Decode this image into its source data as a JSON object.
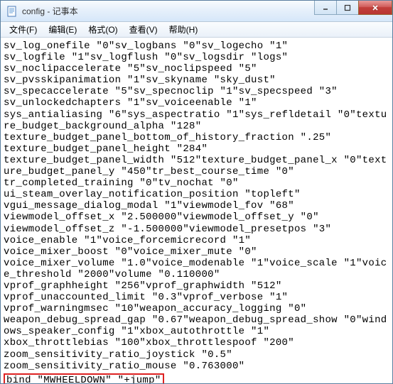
{
  "window": {
    "title": "config - 记事本"
  },
  "menu": {
    "file": "文件(F)",
    "edit": "编辑(E)",
    "format": "格式(O)",
    "view": "查看(V)",
    "help": "帮助(H)"
  },
  "content": {
    "lines": "sv_log_onefile \"0\"sv_logbans \"0\"sv_logecho \"1\"\nsv_logfile \"1\"sv_logflush \"0\"sv_logsdir \"logs\"\nsv_noclipaccelerate \"5\"sv_noclipspeed \"5\"\nsv_pvsskipanimation \"1\"sv_skyname \"sky_dust\"\nsv_specaccelerate \"5\"sv_specnoclip \"1\"sv_specspeed \"3\"\nsv_unlockedchapters \"1\"sv_voiceenable \"1\"\nsys_antialiasing \"6\"sys_aspectratio \"1\"sys_refldetail \"0\"texture_budget_background_alpha \"128\"\ntexture_budget_panel_bottom_of_history_fraction \".25\"\ntexture_budget_panel_height \"284\"\ntexture_budget_panel_width \"512\"texture_budget_panel_x \"0\"texture_budget_panel_y \"450\"tr_best_course_time \"0\"\ntr_completed_training \"0\"tv_nochat \"0\"\nui_steam_overlay_notification_position \"topleft\"\nvgui_message_dialog_modal \"1\"viewmodel_fov \"68\"\nviewmodel_offset_x \"2.500000\"viewmodel_offset_y \"0\"\nviewmodel_offset_z \"-1.500000\"viewmodel_presetpos \"3\"\nvoice_enable \"1\"voice_forcemicrecord \"1\"\nvoice_mixer_boost \"0\"voice_mixer_mute \"0\"\nvoice_mixer_volume \"1.0\"voice_modenable \"1\"voice_scale \"1\"voice_threshold \"2000\"volume \"0.110000\"\nvprof_graphheight \"256\"vprof_graphwidth \"512\"\nvprof_unaccounted_limit \"0.3\"vprof_verbose \"1\"\nvprof_warningmsec \"10\"weapon_accuracy_logging \"0\"\nweapon_debug_spread_gap \"0.67\"weapon_debug_spread_show \"0\"windows_speaker_config \"1\"xbox_autothrottle \"1\"\nxbox_throttlebias \"100\"xbox_throttlespoof \"200\"\nzoom_sensitivity_ratio_joystick \"0.5\"\nzoom_sensitivity_ratio_mouse \"0.763000\"",
    "highlighted": "bind \"MWHEELDOWN\" \"+jump\""
  }
}
